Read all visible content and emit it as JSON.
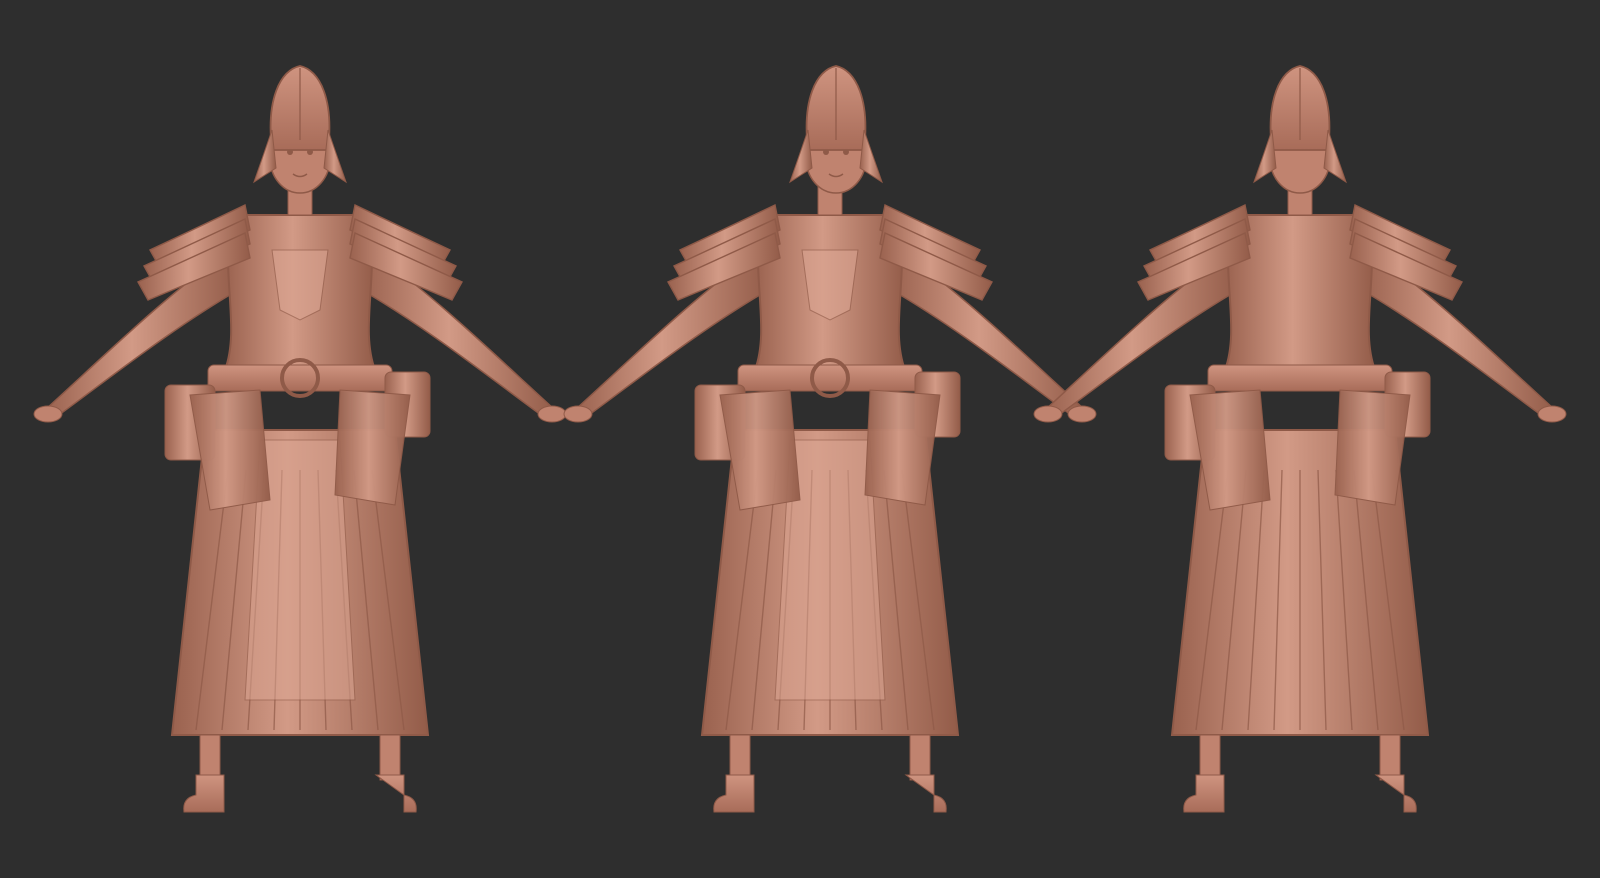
{
  "scene": {
    "background_color": "#2e2e2e",
    "clay_color": "#c0836f",
    "clay_shadow": "#8f5a48",
    "clay_highlight": "#dba592",
    "views": [
      {
        "view": "front"
      },
      {
        "view": "three-quarter"
      },
      {
        "view": "back"
      }
    ]
  }
}
